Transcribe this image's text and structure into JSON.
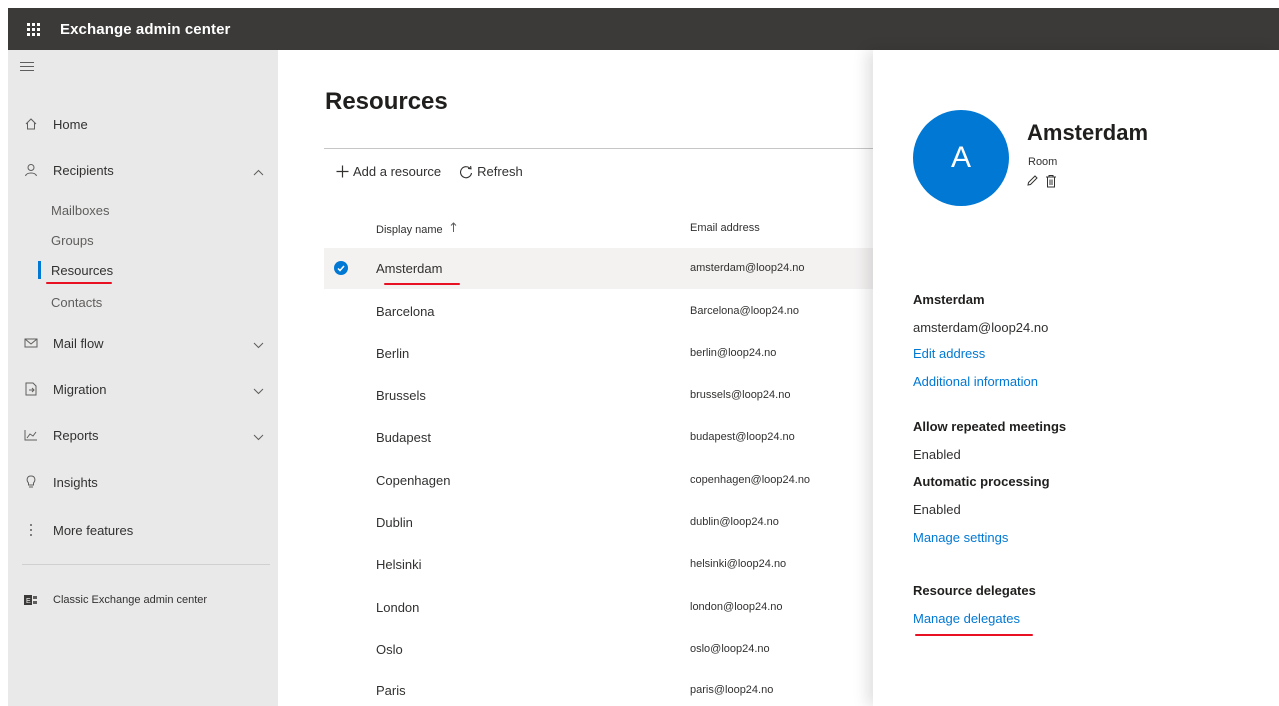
{
  "header": {
    "app_title": "Exchange admin center"
  },
  "sidebar": {
    "home": "Home",
    "recipients": "Recipients",
    "sub_items": [
      "Mailboxes",
      "Groups",
      "Resources",
      "Contacts"
    ],
    "mail_flow": "Mail flow",
    "migration": "Migration",
    "reports": "Reports",
    "insights": "Insights",
    "more_features": "More features",
    "classic": "Classic Exchange admin center"
  },
  "main": {
    "title": "Resources",
    "add_label": "Add a resource",
    "refresh_label": "Refresh",
    "columns": {
      "display_name": "Display name",
      "email": "Email address"
    },
    "rows": [
      {
        "name": "Amsterdam",
        "email": "amsterdam@loop24.no"
      },
      {
        "name": "Barcelona",
        "email": "Barcelona@loop24.no"
      },
      {
        "name": "Berlin",
        "email": "berlin@loop24.no"
      },
      {
        "name": "Brussels",
        "email": "brussels@loop24.no"
      },
      {
        "name": "Budapest",
        "email": "budapest@loop24.no"
      },
      {
        "name": "Copenhagen",
        "email": "copenhagen@loop24.no"
      },
      {
        "name": "Dublin",
        "email": "dublin@loop24.no"
      },
      {
        "name": "Helsinki",
        "email": "helsinki@loop24.no"
      },
      {
        "name": "London",
        "email": "london@loop24.no"
      },
      {
        "name": "Oslo",
        "email": "oslo@loop24.no"
      },
      {
        "name": "Paris",
        "email": "paris@loop24.no"
      }
    ]
  },
  "panel": {
    "avatar_letter": "A",
    "name": "Amsterdam",
    "type": "Room",
    "section_name": "Amsterdam",
    "email": "amsterdam@loop24.no",
    "edit_address": "Edit address",
    "additional_info": "Additional information",
    "allow_repeated_heading": "Allow repeated meetings",
    "allow_repeated_value": "Enabled",
    "auto_processing_heading": "Automatic processing",
    "auto_processing_value": "Enabled",
    "manage_settings": "Manage settings",
    "delegates_heading": "Resource delegates",
    "manage_delegates": "Manage delegates"
  },
  "colors": {
    "accent": "#0078d4",
    "topbar": "#3b3a39",
    "sidebar": "#e9e9e9",
    "highlight": "#e81123"
  }
}
